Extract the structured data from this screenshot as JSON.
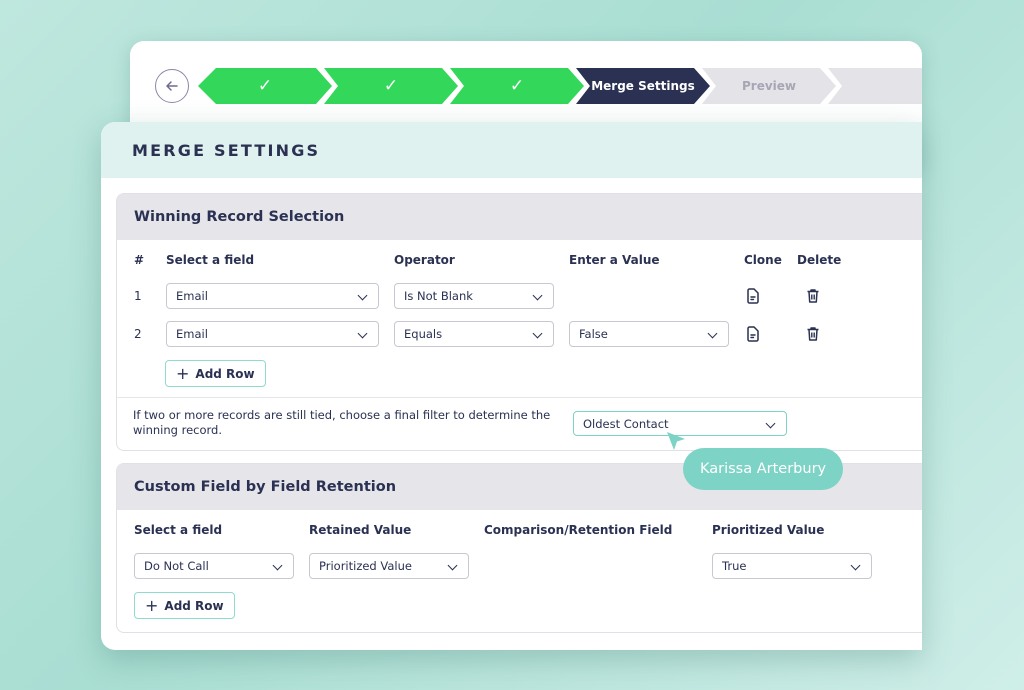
{
  "wizard": {
    "back_label": "Back",
    "steps": [
      {
        "label": "",
        "state": "done",
        "icon": "check-icon"
      },
      {
        "label": "",
        "state": "done",
        "icon": "check-icon"
      },
      {
        "label": "",
        "state": "done",
        "icon": "check-icon"
      },
      {
        "label": "Merge Settings",
        "state": "current"
      },
      {
        "label": "Preview",
        "state": "upcoming"
      },
      {
        "label": "",
        "state": "upcoming"
      }
    ],
    "check_glyph": "✓"
  },
  "page": {
    "title": "MERGE SETTINGS"
  },
  "winning_record": {
    "title": "Winning Record Selection",
    "columns": {
      "num": "#",
      "field": "Select a field",
      "operator": "Operator",
      "value": "Enter a Value",
      "clone": "Clone",
      "delete": "Delete"
    },
    "rows": [
      {
        "num": "1",
        "field": "Email",
        "operator": "Is Not Blank",
        "value": null
      },
      {
        "num": "2",
        "field": "Email",
        "operator": "Equals",
        "value": "False"
      }
    ],
    "add_row_label": "Add Row",
    "tie_text": "If two or more records are still tied, choose a final filter to determine the winning record.",
    "tie_filter": "Oldest Contact"
  },
  "retention": {
    "title": "Custom Field by Field Retention",
    "columns": {
      "field": "Select a field",
      "retained": "Retained Value",
      "comparison": "Comparison/Retention Field",
      "prioritized": "Prioritized Value"
    },
    "rows": [
      {
        "field": "Do Not Call",
        "retained": "Prioritized Value",
        "comparison": null,
        "prioritized": "True"
      }
    ],
    "add_row_label": "Add Row"
  },
  "collaborator": {
    "name": "Karissa Arterbury"
  },
  "colors": {
    "step_done": "#33d85a",
    "step_current": "#2a3152",
    "step_upcoming": "#e4e3e8",
    "accent_teal": "#7dd3c5",
    "header_tint": "#dff2ef",
    "text_navy": "#2a3152"
  }
}
